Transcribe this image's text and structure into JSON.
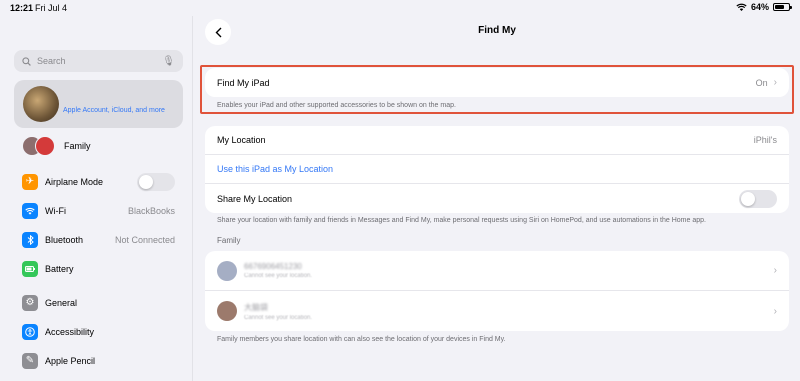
{
  "status_bar": {
    "time": "12:21",
    "date": "Fri Jul 4",
    "battery": "64%",
    "battery_level": 0.64
  },
  "sidebar": {
    "search_placeholder": "Search",
    "account_subtitle": "Apple Account, iCloud, and more",
    "family_label": "Family",
    "group1": [
      {
        "label": "Airplane Mode",
        "icon": "airplane-icon",
        "color": "#ff9500",
        "toggle": false
      },
      {
        "label": "Wi-Fi",
        "icon": "wifi-icon",
        "color": "#0a84ff",
        "value": "BlackBooks"
      },
      {
        "label": "Bluetooth",
        "icon": "bluetooth-icon",
        "color": "#0a84ff",
        "value": "Not Connected"
      },
      {
        "label": "Battery",
        "icon": "battery-icon",
        "color": "#34c759"
      }
    ],
    "group2": [
      {
        "label": "General",
        "icon": "gear-icon",
        "color": "#8e8e93"
      },
      {
        "label": "Accessibility",
        "icon": "accessibility-icon",
        "color": "#0a84ff"
      },
      {
        "label": "Apple Pencil",
        "icon": "pencil-icon",
        "color": "#8e8e93"
      }
    ]
  },
  "main": {
    "title": "Find My",
    "find_my_ipad": {
      "label": "Find My iPad",
      "value": "On",
      "note": "Enables your iPad and other supported accessories to be shown on the map."
    },
    "location": {
      "my_location_label": "My Location",
      "my_location_value": "iPhil's",
      "use_this_ipad": "Use this iPad as My Location",
      "share_label": "Share My Location",
      "share_enabled": false,
      "note": "Share your location with family and friends in Messages and Find My, make personal requests using Siri on HomePod, and use automations in the Home app."
    },
    "family_header": "Family",
    "family_members": [
      {
        "name": "6676906451230",
        "status": "Cannot see your location."
      },
      {
        "name": "大脑袋",
        "status": "Cannot see your location."
      }
    ],
    "family_note": "Family members you share location with can also see the location of your devices in Find My."
  }
}
